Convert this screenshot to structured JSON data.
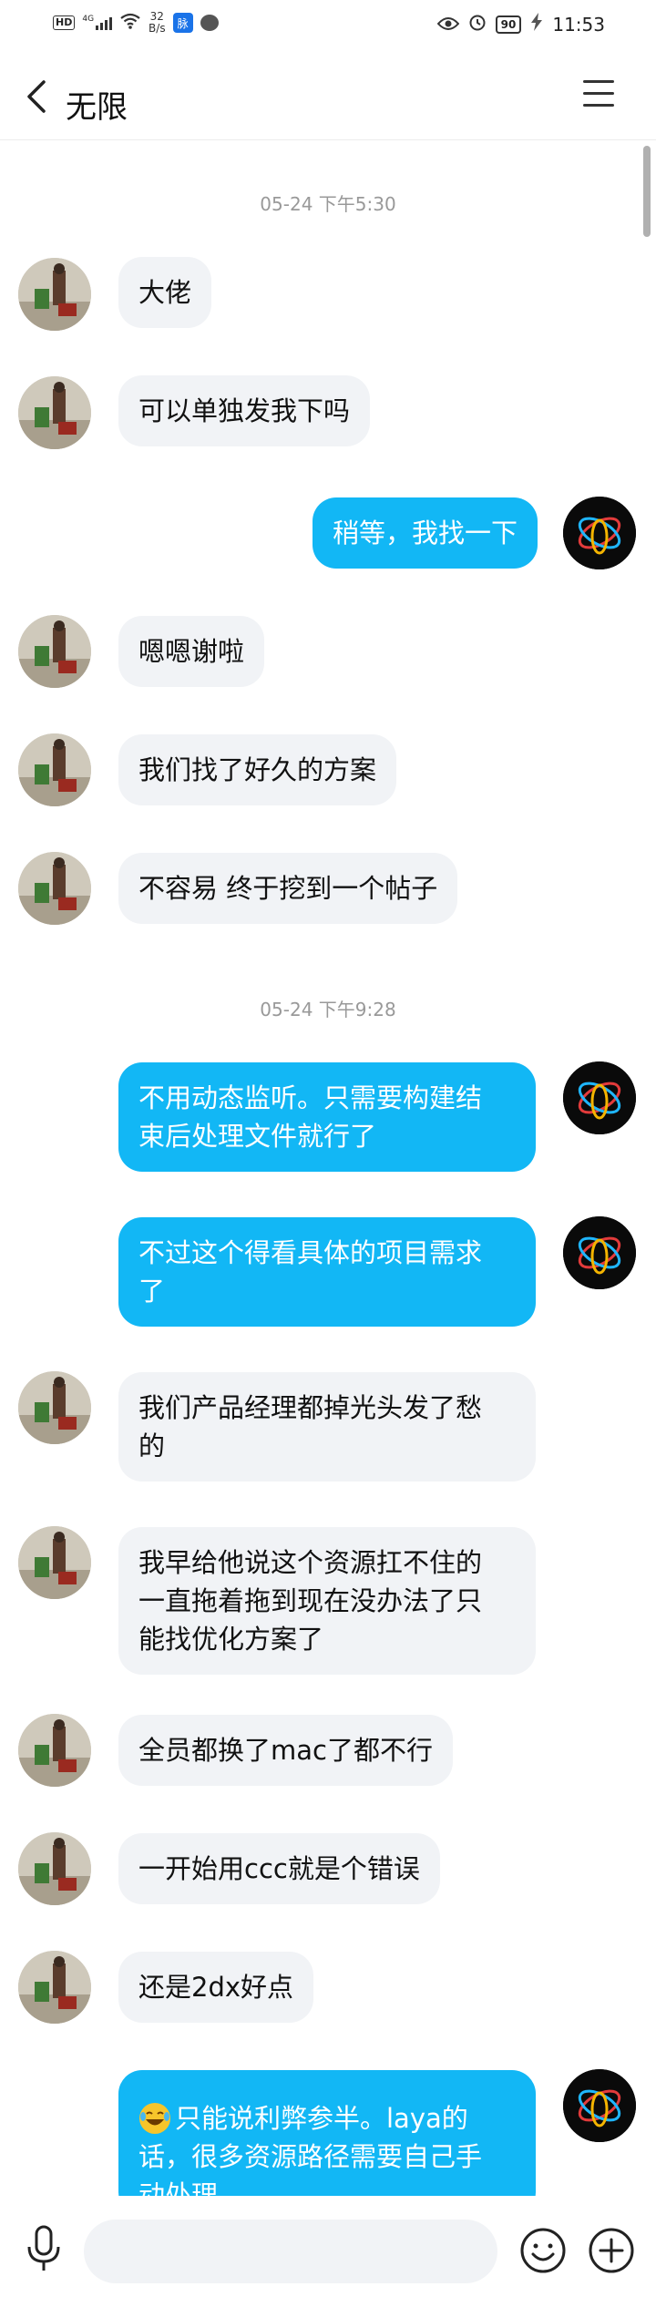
{
  "status_bar": {
    "network_badge": "HD",
    "signal": "4G",
    "speed_value": "32",
    "speed_unit": "B/s",
    "app_icon_text": "脉",
    "battery": "90",
    "time": "11:53"
  },
  "header": {
    "title": "无限"
  },
  "messages": [
    {
      "type": "timestamp",
      "text": "05-24 下午5:30"
    },
    {
      "from": "other",
      "text": "大佬"
    },
    {
      "from": "other",
      "text": "可以单独发我下吗"
    },
    {
      "from": "me",
      "text": "稍等，我找一下"
    },
    {
      "from": "other",
      "text": "嗯嗯谢啦"
    },
    {
      "from": "other",
      "text": "我们找了好久的方案"
    },
    {
      "from": "other",
      "text": "不容易 终于挖到一个帖子"
    },
    {
      "type": "timestamp",
      "text": "05-24 下午9:28"
    },
    {
      "from": "me",
      "line1": "不用动态监听。只需要构建结",
      "line2": "束后处理文件就行了"
    },
    {
      "from": "me",
      "line1": "不过这个得看具体的项目需求",
      "line2": "了"
    },
    {
      "from": "other",
      "line1": "我们产品经理都掉光头发了愁",
      "line2": "的"
    },
    {
      "from": "other",
      "line1": "我早给他说这个资源扛不住的",
      "line2": "一直拖着拖到现在没办法了只",
      "line3": "能找优化方案了"
    },
    {
      "from": "other",
      "text": "全员都换了mac了都不行"
    },
    {
      "from": "other",
      "text": "一开始用ccc就是个错误"
    },
    {
      "from": "other",
      "text": "还是2dx好点"
    },
    {
      "from": "me",
      "line1": "只能说利弊参半。laya的",
      "line2": "话，很多资源路径需要自己手",
      "line3": "动处理"
    }
  ],
  "colors": {
    "accent": "#12b7f5",
    "other_bubble": "#f1f3f6"
  },
  "icons": {
    "back": "chevron-left-icon",
    "menu": "hamburger-icon",
    "mic": "microphone-icon",
    "emoji": "smiley-icon",
    "plus": "plus-circle-icon"
  }
}
